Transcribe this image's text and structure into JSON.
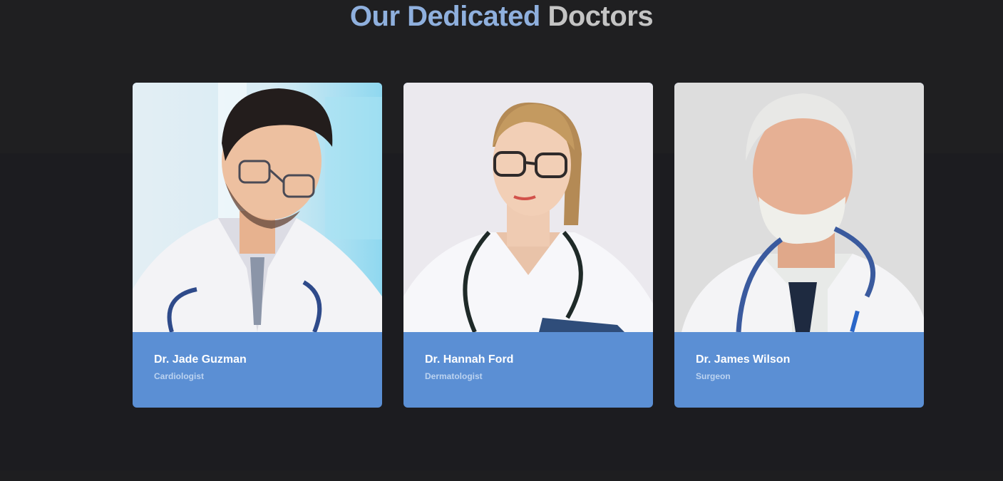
{
  "section": {
    "title_accent": "Our Dedicated",
    "title_rest": "Doctors"
  },
  "doctors": [
    {
      "name": "Dr. Jade Guzman",
      "role": "Cardiologist"
    },
    {
      "name": "Dr. Hannah Ford",
      "role": "Dermatologist"
    },
    {
      "name": "Dr. James Wilson",
      "role": "Surgeon"
    }
  ],
  "colors": {
    "accent": "#8fb0de",
    "card": "#5b8fd4",
    "background": "#1c1c20"
  }
}
